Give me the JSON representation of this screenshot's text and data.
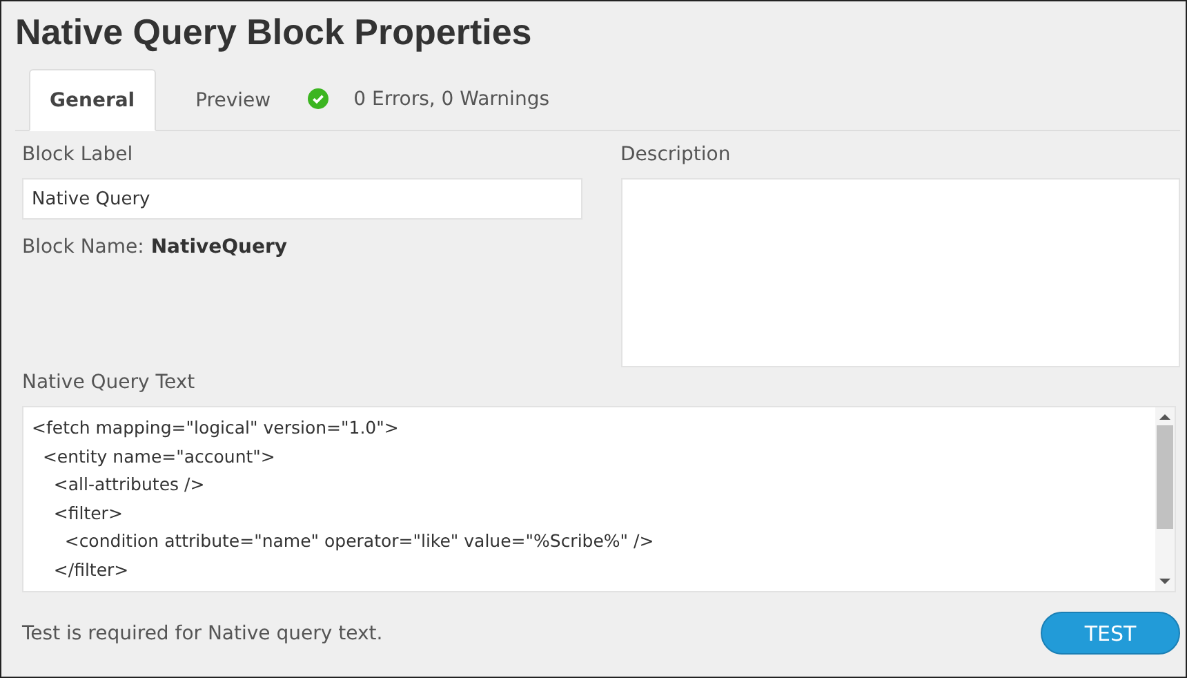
{
  "window": {
    "title": "Native Query Block Properties"
  },
  "tabs": [
    {
      "label": "General",
      "selected": true
    },
    {
      "label": "Preview",
      "selected": false
    }
  ],
  "status": {
    "kind": "ok",
    "text": "0 Errors, 0 Warnings"
  },
  "block_label": {
    "label": "Block Label",
    "value": "Native Query"
  },
  "block_name": {
    "label": "Block Name:",
    "value": "NativeQuery"
  },
  "description": {
    "label": "Description"
  },
  "query": {
    "label": "Native Query Text",
    "lines": [
      "<fetch mapping=\"logical\" version=\"1.0\">",
      "  <entity name=\"account\">",
      "    <all-attributes />",
      "    <filter>",
      "      <condition attribute=\"name\" operator=\"like\" value=\"%Scribe%\" />",
      "    </filter>"
    ]
  },
  "footer": {
    "message": "Test is required for Native query text.",
    "button": "TEST"
  }
}
